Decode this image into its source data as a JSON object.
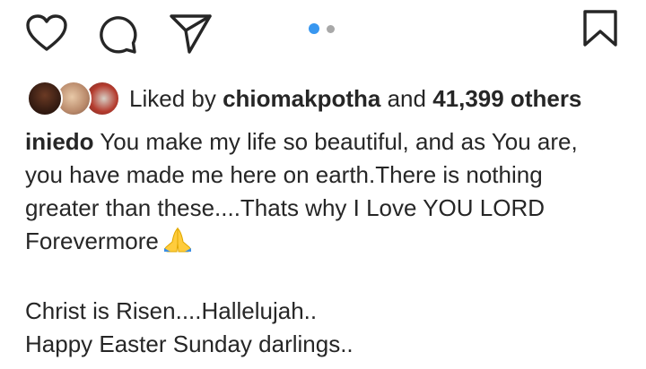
{
  "actions": {
    "like_icon": "heart-icon",
    "comment_icon": "comment-icon",
    "share_icon": "paper-plane-icon",
    "save_icon": "bookmark-icon",
    "carousel_index": 1,
    "carousel_total": 2
  },
  "likes": {
    "prefix": "Liked by",
    "user": "chiomakpotha",
    "joiner": "and",
    "count": "41,399 others"
  },
  "caption": {
    "username": "iniedo",
    "line1": "You make my life so beautiful, and as You are,",
    "line2": "you have made me here on earth.There is nothing",
    "line3": "greater than these....Thats why I Love YOU LORD",
    "line4": "Forevermore",
    "emoji": "🙏",
    "line5": "Christ is Risen....Hallelujah..",
    "line6": "Happy Easter Sunday darlings.."
  },
  "colors": {
    "text": "#262626",
    "carousel_active": "#3897f0",
    "carousel_inactive": "#a8a8a8"
  }
}
